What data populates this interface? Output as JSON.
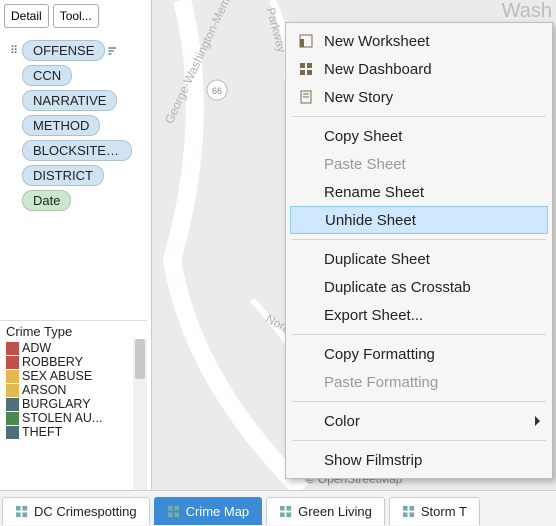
{
  "marks": {
    "detail": "Detail",
    "tooltip": "Tool..."
  },
  "shelf": {
    "pills": [
      {
        "label": "OFFENSE",
        "color": "blue",
        "has_sort": true
      },
      {
        "label": "CCN",
        "color": "blue"
      },
      {
        "label": "NARRATIVE",
        "color": "blue"
      },
      {
        "label": "METHOD",
        "color": "blue"
      },
      {
        "label": "BLOCKSITEA...",
        "color": "blue"
      },
      {
        "label": "DISTRICT",
        "color": "blue"
      },
      {
        "label": "Date",
        "color": "green"
      }
    ]
  },
  "legend": {
    "title": "Crime Type",
    "items": [
      {
        "label": "ADW",
        "color": "#c1514d"
      },
      {
        "label": "ROBBERY",
        "color": "#c1514d"
      },
      {
        "label": "SEX ABUSE",
        "color": "#e3b94f"
      },
      {
        "label": "ARSON",
        "color": "#e3b94f"
      },
      {
        "label": "BURGLARY",
        "color": "#4f6f7a"
      },
      {
        "label": "STOLEN AU...",
        "color": "#4a8a52"
      },
      {
        "label": "THEFT",
        "color": "#4f6f7a"
      }
    ]
  },
  "map": {
    "attribution": "© OpenStreetMap",
    "city_label": "Wash",
    "labels": [
      "George-Washington-Memorial-Parkway",
      "North-Jefferson",
      "Parkway"
    ]
  },
  "tabs": [
    {
      "label": "DC Crimespotting",
      "active": false
    },
    {
      "label": "Crime Map",
      "active": true
    },
    {
      "label": "Green Living",
      "active": false
    },
    {
      "label": "Storm T",
      "active": false
    }
  ],
  "context_menu": {
    "items": [
      {
        "label": "New Worksheet",
        "icon": "worksheet",
        "enabled": true
      },
      {
        "label": "New Dashboard",
        "icon": "dashboard",
        "enabled": true
      },
      {
        "label": "New Story",
        "icon": "story",
        "enabled": true
      },
      {
        "sep": true
      },
      {
        "label": "Copy Sheet",
        "enabled": true
      },
      {
        "label": "Paste Sheet",
        "enabled": false
      },
      {
        "label": "Rename Sheet",
        "enabled": true
      },
      {
        "label": "Unhide Sheet",
        "enabled": true,
        "highlight": true
      },
      {
        "sep": true
      },
      {
        "label": "Duplicate Sheet",
        "enabled": true
      },
      {
        "label": "Duplicate as Crosstab",
        "enabled": true
      },
      {
        "label": "Export Sheet...",
        "enabled": true
      },
      {
        "sep": true
      },
      {
        "label": "Copy Formatting",
        "enabled": true
      },
      {
        "label": "Paste Formatting",
        "enabled": false
      },
      {
        "sep": true
      },
      {
        "label": "Color",
        "enabled": true,
        "submenu": true
      },
      {
        "sep": true
      },
      {
        "label": "Show Filmstrip",
        "enabled": true
      }
    ]
  }
}
